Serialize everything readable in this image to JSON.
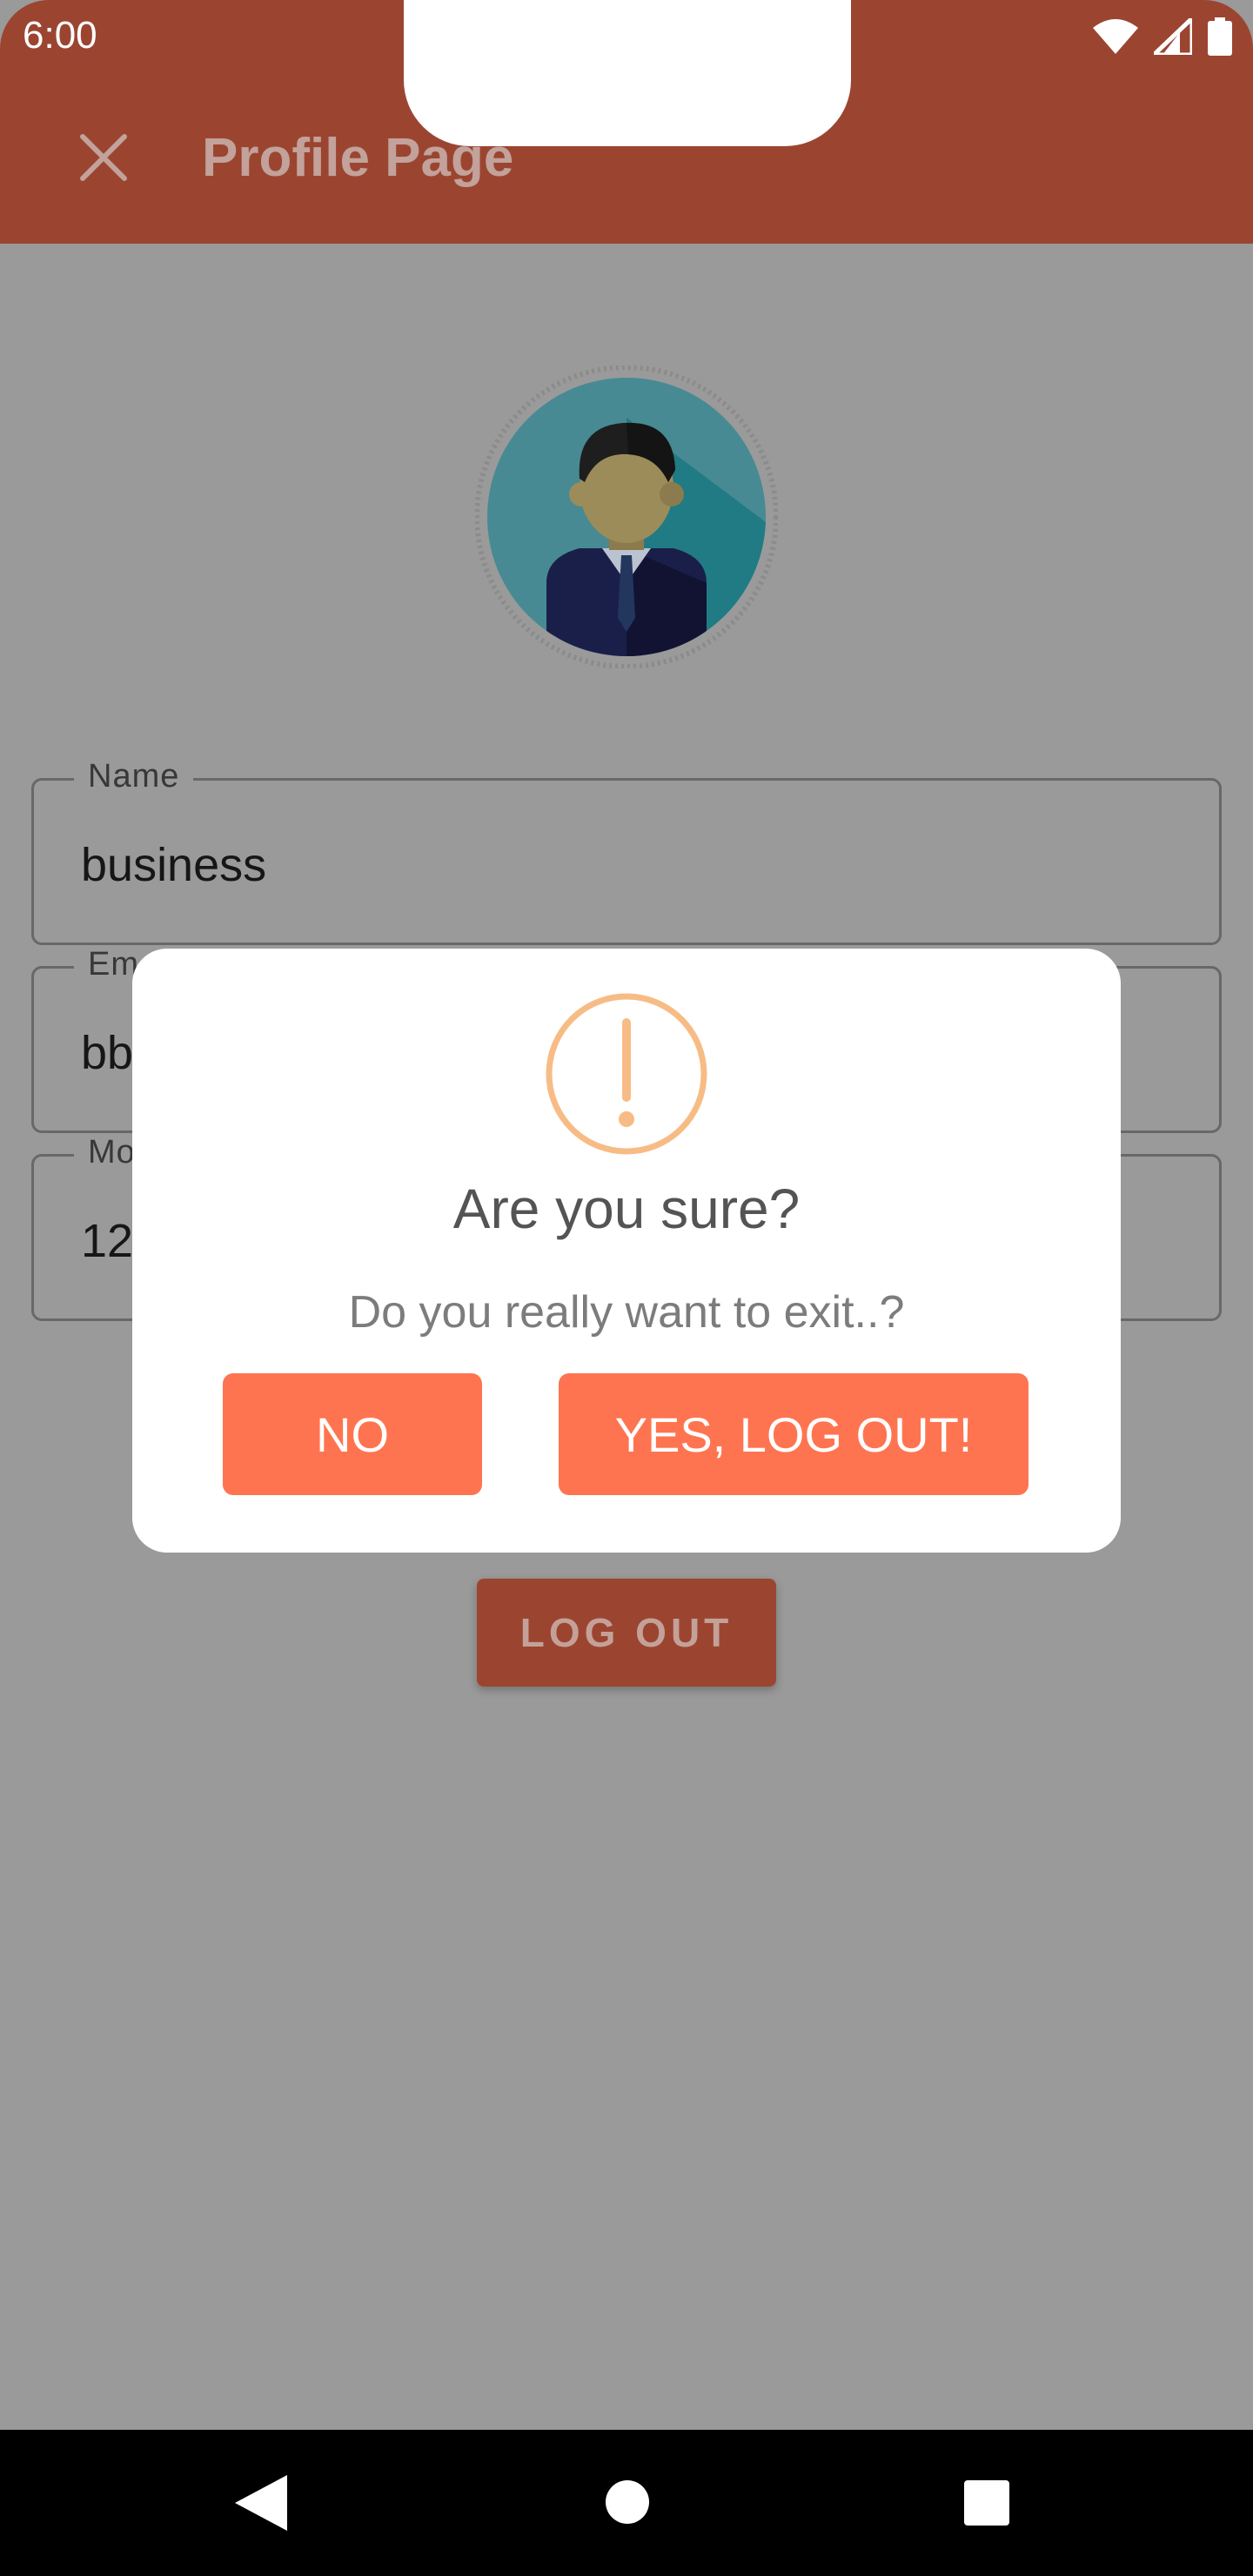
{
  "status_bar": {
    "time": "6:00",
    "icons": [
      "wifi-icon",
      "signal-icon",
      "battery-icon"
    ]
  },
  "app_bar": {
    "title": "Profile Page",
    "close_icon": "close-icon"
  },
  "profile": {
    "avatar": "businessman-avatar"
  },
  "form": {
    "fields": [
      {
        "label": "Name",
        "value": "business"
      },
      {
        "label": "Em",
        "value": "bb"
      },
      {
        "label": "Mo",
        "value": "12"
      }
    ]
  },
  "logout_button": {
    "label": "LOG OUT"
  },
  "dialog": {
    "icon": "warning-exclamation-icon",
    "title": "Are you sure?",
    "message": "Do you really want to exit..?",
    "no_label": "NO",
    "yes_label": "YES, LOG OUT!"
  },
  "nav_bar": {
    "back_icon": "back-icon",
    "home_icon": "home-icon",
    "recents_icon": "recents-icon"
  },
  "colors": {
    "app_bar": "#9b4531",
    "dialog_button": "#ff7450",
    "warning_icon": "#f7bc85",
    "overlay_background": "#9a9a9a"
  }
}
